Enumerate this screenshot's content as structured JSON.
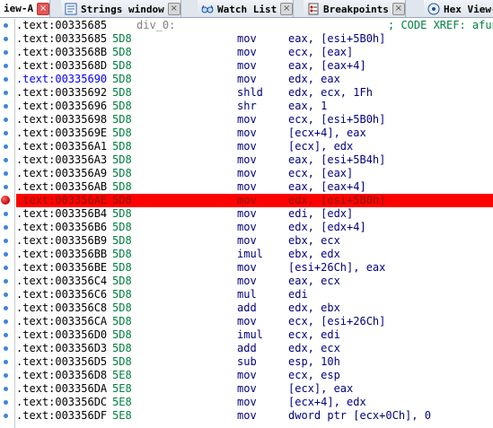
{
  "tabs": [
    {
      "label": "iew-A",
      "icon": "",
      "active": true
    },
    {
      "label": "Strings window",
      "icon": "strings-icon",
      "active": false
    },
    {
      "label": "Watch List",
      "icon": "glasses-icon",
      "active": false
    },
    {
      "label": "Breakpoints",
      "icon": "breakpoints-icon",
      "active": false
    },
    {
      "label": "Hex View-",
      "icon": "hex-icon",
      "active": false
    }
  ],
  "header_row": {
    "address": ".text:00335685",
    "label": "div_0:",
    "comment": "; CODE XREF: afun"
  },
  "rows": [
    {
      "address": ".text:00335685",
      "bytes": "5D8",
      "mnemonic": "mov",
      "operands": "eax, [esi+5B0h]"
    },
    {
      "address": ".text:0033568B",
      "bytes": "5D8",
      "mnemonic": "mov",
      "operands": "ecx, [eax]"
    },
    {
      "address": ".text:0033568D",
      "bytes": "5D8",
      "mnemonic": "mov",
      "operands": "eax, [eax+4]"
    },
    {
      "address": ".text:00335690",
      "bytes": "5D8",
      "mnemonic": "mov",
      "operands": "edx, eax",
      "highlight_address": true
    },
    {
      "address": ".text:00335692",
      "bytes": "5D8",
      "mnemonic": "shld",
      "operands": "edx, ecx, 1Fh"
    },
    {
      "address": ".text:00335696",
      "bytes": "5D8",
      "mnemonic": "shr",
      "operands": "eax, 1"
    },
    {
      "address": ".text:00335698",
      "bytes": "5D8",
      "mnemonic": "mov",
      "operands": "ecx, [esi+5B0h]"
    },
    {
      "address": ".text:0033569E",
      "bytes": "5D8",
      "mnemonic": "mov",
      "operands": "[ecx+4], eax"
    },
    {
      "address": ".text:003356A1",
      "bytes": "5D8",
      "mnemonic": "mov",
      "operands": "[ecx], edx"
    },
    {
      "address": ".text:003356A3",
      "bytes": "5D8",
      "mnemonic": "mov",
      "operands": "eax, [esi+5B4h]"
    },
    {
      "address": ".text:003356A9",
      "bytes": "5D8",
      "mnemonic": "mov",
      "operands": "ecx, [eax]"
    },
    {
      "address": ".text:003356AB",
      "bytes": "5D8",
      "mnemonic": "mov",
      "operands": "eax, [eax+4]"
    },
    {
      "address": ".text:003356AE",
      "bytes": "5D8",
      "mnemonic": "mov",
      "operands": "edx, [esi+5B0h]",
      "breakpoint": true
    },
    {
      "address": ".text:003356B4",
      "bytes": "5D8",
      "mnemonic": "mov",
      "operands": "edi, [edx]"
    },
    {
      "address": ".text:003356B6",
      "bytes": "5D8",
      "mnemonic": "mov",
      "operands": "edx, [edx+4]"
    },
    {
      "address": ".text:003356B9",
      "bytes": "5D8",
      "mnemonic": "mov",
      "operands": "ebx, ecx"
    },
    {
      "address": ".text:003356BB",
      "bytes": "5D8",
      "mnemonic": "imul",
      "operands": "ebx, edx"
    },
    {
      "address": ".text:003356BE",
      "bytes": "5D8",
      "mnemonic": "mov",
      "operands": "[esi+26Ch], eax"
    },
    {
      "address": ".text:003356C4",
      "bytes": "5D8",
      "mnemonic": "mov",
      "operands": "eax, ecx"
    },
    {
      "address": ".text:003356C6",
      "bytes": "5D8",
      "mnemonic": "mul",
      "operands": "edi"
    },
    {
      "address": ".text:003356C8",
      "bytes": "5D8",
      "mnemonic": "add",
      "operands": "edx, ebx"
    },
    {
      "address": ".text:003356CA",
      "bytes": "5D8",
      "mnemonic": "mov",
      "operands": "ecx, [esi+26Ch]"
    },
    {
      "address": ".text:003356D0",
      "bytes": "5D8",
      "mnemonic": "imul",
      "operands": "ecx, edi"
    },
    {
      "address": ".text:003356D3",
      "bytes": "5D8",
      "mnemonic": "add",
      "operands": "edx, ecx"
    },
    {
      "address": ".text:003356D5",
      "bytes": "5D8",
      "mnemonic": "sub",
      "operands": "esp, 10h"
    },
    {
      "address": ".text:003356D8",
      "bytes": "5E8",
      "mnemonic": "mov",
      "operands": "ecx, esp"
    },
    {
      "address": ".text:003356DA",
      "bytes": "5E8",
      "mnemonic": "mov",
      "operands": "[ecx], eax"
    },
    {
      "address": ".text:003356DC",
      "bytes": "5E8",
      "mnemonic": "mov",
      "operands": "[ecx+4], edx"
    },
    {
      "address": ".text:003356DF",
      "bytes": "5E8",
      "mnemonic": "mov",
      "operands": "dword ptr [ecx+0Ch], 0"
    }
  ],
  "colors": {
    "breakpoint_row": "#ff0000",
    "gutter_dot": "#3d86d8",
    "address": "#000000",
    "bytes": "#008040",
    "instruction": "#000080",
    "comment": "#008040"
  }
}
